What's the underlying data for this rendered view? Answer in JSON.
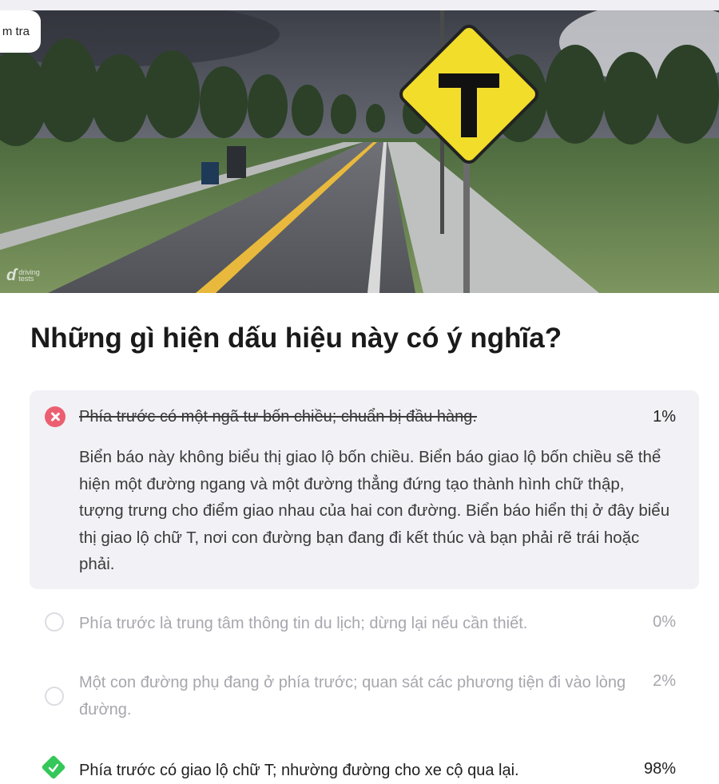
{
  "hero": {
    "tag_label": "m tra",
    "watermark_line1": "driving",
    "watermark_line2": "tests",
    "sign_letter": "T"
  },
  "question": {
    "title": "Những gì hiện dấu hiệu này có ý nghĩa?"
  },
  "answers": [
    {
      "text": "Phía trước có một ngã tư bốn chiều; chuẩn bị đầu hàng.",
      "percent": "1%",
      "state": "wrong-selected",
      "explanation": "Biển báo này không biểu thị giao lộ bốn chiều. Biển báo giao lộ bốn chiều sẽ thể hiện một đường ngang và một đường thẳng đứng tạo thành hình chữ thập, tượng trưng cho điểm giao nhau của hai con đường. Biển báo hiển thị ở đây biểu thị giao lộ chữ T, nơi con đường bạn đang đi kết thúc và bạn phải rẽ trái hoặc phải."
    },
    {
      "text": "Phía trước là trung tâm thông tin du lịch; dừng lại nếu cần thiết.",
      "percent": "0%",
      "state": "unselected"
    },
    {
      "text": "Một con đường phụ đang ở phía trước; quan sát các phương tiện đi vào lòng đường.",
      "percent": "2%",
      "state": "unselected"
    },
    {
      "text": "Phía trước có giao lộ chữ T; nhường đường cho xe cộ qua lại.",
      "percent": "98%",
      "state": "correct"
    }
  ],
  "colors": {
    "wrong_icon": "#ec5f70",
    "correct_icon": "#35c759",
    "explanation_bg": "#f1f1f6",
    "sign_yellow": "#f2dd2a"
  }
}
